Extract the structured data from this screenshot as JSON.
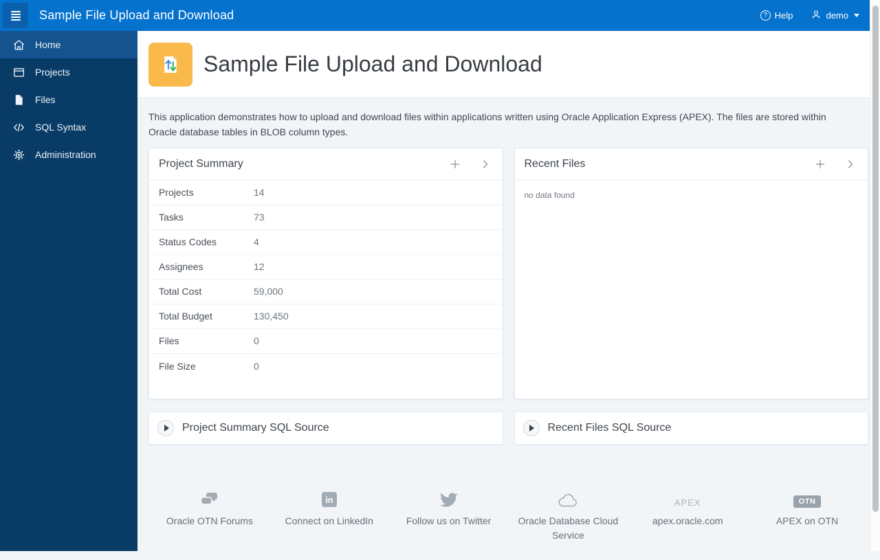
{
  "header": {
    "app_title": "Sample File Upload and Download",
    "help_label": "Help",
    "help_glyph": "?",
    "user_name": "demo",
    "icons": [
      "hamburger-menu-icon",
      "help-circle-icon",
      "person-icon",
      "caret-down-icon"
    ]
  },
  "sidebar": {
    "items": [
      {
        "label": "Home",
        "icon": "home-icon",
        "active": true
      },
      {
        "label": "Projects",
        "icon": "projects-icon",
        "active": false
      },
      {
        "label": "Files",
        "icon": "files-icon",
        "active": false
      },
      {
        "label": "SQL Syntax",
        "icon": "sql-syntax-icon",
        "active": false
      },
      {
        "label": "Administration",
        "icon": "administration-gear-icon",
        "active": false
      }
    ]
  },
  "page": {
    "title": "Sample File Upload and Download",
    "title_icon": "file-upload-download-icon",
    "description": "This application demonstrates how to upload and download files within applications written using Oracle Application Express (APEX). The files are stored within Oracle database tables in BLOB column types."
  },
  "project_summary": {
    "title": "Project Summary",
    "action_icons": [
      "add-icon",
      "open-region-icon"
    ],
    "rows": [
      {
        "label": "Projects",
        "value": "14"
      },
      {
        "label": "Tasks",
        "value": "73"
      },
      {
        "label": "Status Codes",
        "value": "4"
      },
      {
        "label": "Assignees",
        "value": "12"
      },
      {
        "label": "Total Cost",
        "value": "59,000"
      },
      {
        "label": "Total Budget",
        "value": "130,450"
      },
      {
        "label": "Files",
        "value": "0"
      },
      {
        "label": "File Size",
        "value": "0"
      }
    ]
  },
  "recent_files": {
    "title": "Recent Files",
    "action_icons": [
      "add-icon",
      "open-region-icon"
    ],
    "empty_message": "no data found"
  },
  "sql_sources": {
    "left_label": "Project Summary SQL Source",
    "right_label": "Recent Files SQL Source",
    "expander_icon": "play-expand-icon"
  },
  "footer": {
    "links": [
      {
        "label": "Oracle OTN Forums",
        "icon": "forums-chat-icon"
      },
      {
        "label": "Connect on LinkedIn",
        "icon": "linkedin-icon"
      },
      {
        "label": "Follow us on Twitter",
        "icon": "twitter-bird-icon"
      },
      {
        "label": "Oracle Database Cloud Service",
        "icon": "cloud-icon"
      },
      {
        "label": "apex.oracle.com",
        "icon": "apex-text-icon",
        "icon_text": "APEX"
      },
      {
        "label": "APEX on OTN",
        "icon": "otn-badge-icon",
        "icon_text": "OTN"
      }
    ]
  },
  "colors": {
    "header_bg": "#0572ce",
    "hamburger_bg": "#0a60ad",
    "sidebar_bg": "#083b66",
    "sidebar_active_bg": "#15538f",
    "body_bg": "#f1f5f8",
    "page_icon_bg": "#f9b94b",
    "upload_arrow": "#4a90e2",
    "download_arrow": "#34b35e",
    "muted_icon": "#a3abb3"
  }
}
